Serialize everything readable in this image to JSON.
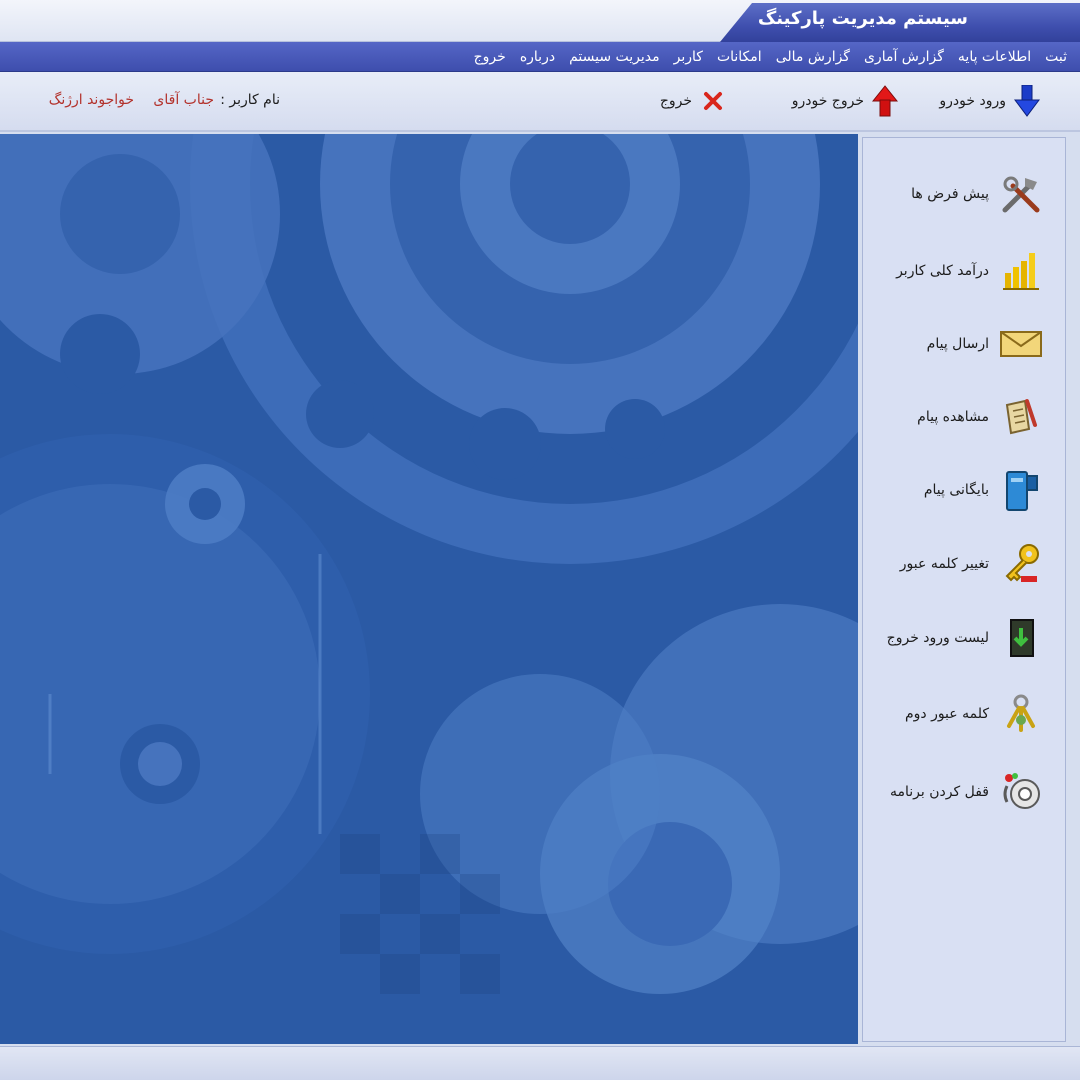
{
  "app": {
    "title": "سیستم مدیریت پارکینگ"
  },
  "menu": [
    {
      "label": "ثبت"
    },
    {
      "label": "اطلاعات پایه"
    },
    {
      "label": "گزارش آماری"
    },
    {
      "label": "گزارش مالی"
    },
    {
      "label": "امکانات"
    },
    {
      "label": "کاربر"
    },
    {
      "label": "مدیریت سیستم"
    },
    {
      "label": "درباره"
    },
    {
      "label": "خروج"
    }
  ],
  "toolbar": {
    "vehicle_entry_label": "ورود خودرو",
    "vehicle_exit_label": "خروج خودرو",
    "exit_label": "خروج",
    "user_label": "نام کاربر :",
    "user_title": "جناب آقای",
    "user_name": "خواجوند ارژنگ"
  },
  "sidebar": {
    "items": [
      {
        "label": "پیش فرض ها",
        "icon": "tools-icon"
      },
      {
        "label": "درآمد کلی کاربر",
        "icon": "income-chart-icon"
      },
      {
        "label": "ارسال پیام",
        "icon": "envelope-icon"
      },
      {
        "label": "مشاهده پیام",
        "icon": "read-message-icon"
      },
      {
        "label": "بایگانی پیام",
        "icon": "archive-icon"
      },
      {
        "label": "تغییر کلمه عبور",
        "icon": "key-icon"
      },
      {
        "label": "لیست ورود خروج",
        "icon": "entry-exit-list-icon"
      },
      {
        "label": "کلمه عبور دوم",
        "icon": "keys-icon"
      },
      {
        "label": "قفل کردن برنامه",
        "icon": "lock-icon"
      }
    ]
  },
  "colors": {
    "menu_bar": "#4454b4",
    "title_tab": "#3f4fae",
    "background_blue": "#2a5aa6",
    "user_name_red": "#b3322c",
    "sidebar_bg": "#d9e0f3"
  }
}
